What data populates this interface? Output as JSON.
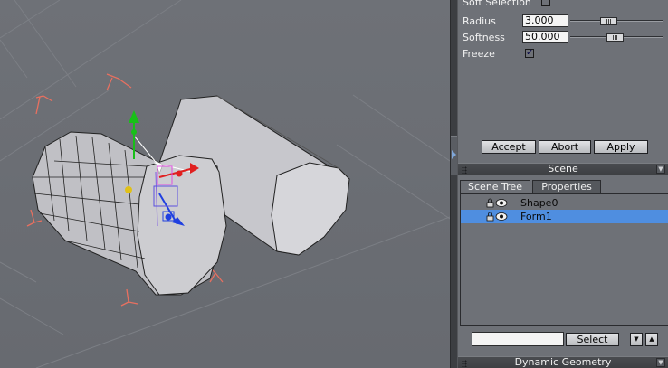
{
  "colors": {
    "viewport_bg": "#6b6e74",
    "panel_bg": "#6e7177",
    "selection": "#4f8ee0",
    "axis_x": "#e02020",
    "axis_y": "#18c018",
    "axis_z": "#2040e0",
    "light_marker": "#e87060"
  },
  "soft_selection": {
    "label": "Soft Selection",
    "checked": false,
    "radius_label": "Radius",
    "radius_value": "3.000",
    "softness_label": "Softness",
    "softness_value": "50.000",
    "freeze_label": "Freeze",
    "freeze_checked": true,
    "checkmark": "✓"
  },
  "actions": {
    "accept": "Accept",
    "abort": "Abort",
    "apply": "Apply"
  },
  "scene_section": {
    "title": "Scene",
    "chevron": "▼",
    "tabs": [
      "Scene Tree",
      "Properties"
    ],
    "active_tab": "Scene Tree",
    "items": [
      {
        "label": "Shape0",
        "selected": false
      },
      {
        "label": "Form1",
        "selected": true
      }
    ],
    "search_value": "",
    "select_button": "Select",
    "down_glyph": "▼",
    "up_glyph": "▲"
  },
  "dynamic_geometry": {
    "title": "Dynamic Geometry",
    "chevron": "▼"
  },
  "icons": [
    "lock-icon",
    "eye-icon",
    "splitter-arrow-icon",
    "gizmo-icon"
  ]
}
